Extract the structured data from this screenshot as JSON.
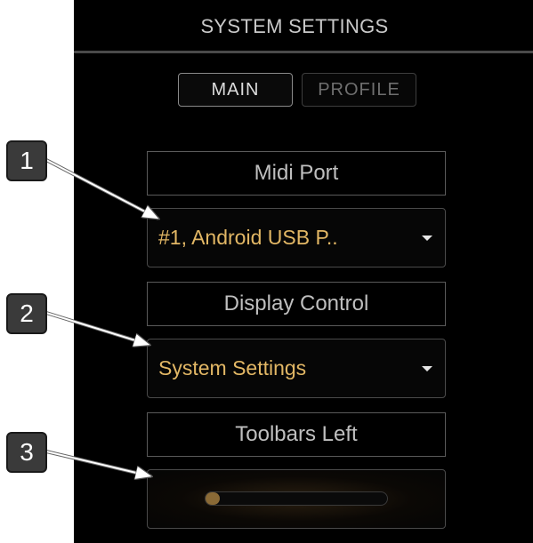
{
  "header": {
    "title": "SYSTEM SETTINGS"
  },
  "tabs": [
    {
      "label": "MAIN",
      "active": true
    },
    {
      "label": "PROFILE",
      "active": false
    }
  ],
  "settings": {
    "midi_port": {
      "label": "Midi Port",
      "value": "#1, Android USB P.."
    },
    "display_control": {
      "label": "Display Control",
      "value": "System Settings"
    },
    "toolbars_left": {
      "label": "Toolbars Left",
      "slider_fraction": 0.05
    }
  },
  "callouts": [
    "1",
    "2",
    "3"
  ],
  "colors": {
    "accent": "#e2b765",
    "background": "#000000",
    "callout_badge": "#3a3a3a",
    "slider_fill": "#8a6a36"
  }
}
